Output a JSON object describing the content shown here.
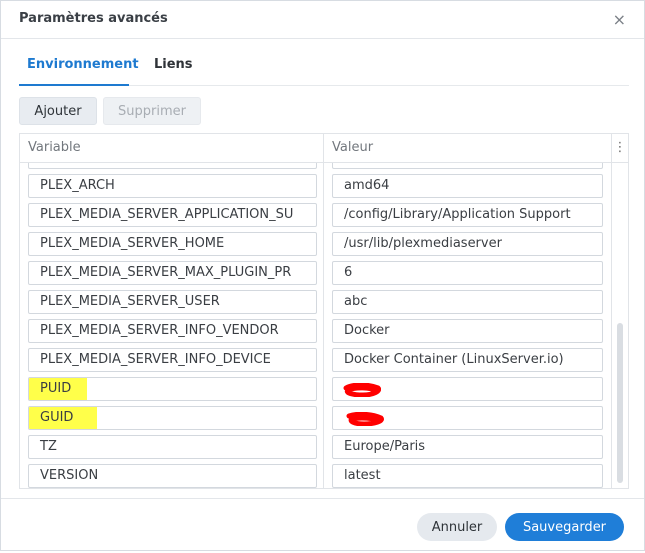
{
  "dialog": {
    "title": "Paramètres avancés",
    "close_icon": "×"
  },
  "tabs": [
    {
      "label": "Environnement",
      "active": true
    },
    {
      "label": "Liens",
      "active": false
    }
  ],
  "toolbar": {
    "add_label": "Ajouter",
    "delete_label": "Supprimer"
  },
  "grid": {
    "headers": {
      "variable": "Variable",
      "value": "Valeur",
      "menu_icon": "⋮"
    },
    "rows": [
      {
        "variable": "PLEX_ARCH",
        "value": "amd64"
      },
      {
        "variable": "PLEX_MEDIA_SERVER_APPLICATION_SU",
        "value": "/config/Library/Application Support"
      },
      {
        "variable": "PLEX_MEDIA_SERVER_HOME",
        "value": "/usr/lib/plexmediaserver"
      },
      {
        "variable": "PLEX_MEDIA_SERVER_MAX_PLUGIN_PR",
        "value": "6"
      },
      {
        "variable": "PLEX_MEDIA_SERVER_USER",
        "value": "abc"
      },
      {
        "variable": "PLEX_MEDIA_SERVER_INFO_VENDOR",
        "value": "Docker"
      },
      {
        "variable": "PLEX_MEDIA_SERVER_INFO_DEVICE",
        "value": "Docker Container (LinuxServer.io)"
      },
      {
        "variable": "PUID",
        "value": ""
      },
      {
        "variable": "GUID",
        "value": ""
      },
      {
        "variable": "TZ",
        "value": "Europe/Paris"
      },
      {
        "variable": "VERSION",
        "value": "latest"
      }
    ]
  },
  "footer": {
    "cancel_label": "Annuler",
    "save_label": "Sauvegarder"
  },
  "colors": {
    "accent": "#1f7ed8",
    "highlight": "#ffff4a",
    "redaction": "#ff0000"
  }
}
